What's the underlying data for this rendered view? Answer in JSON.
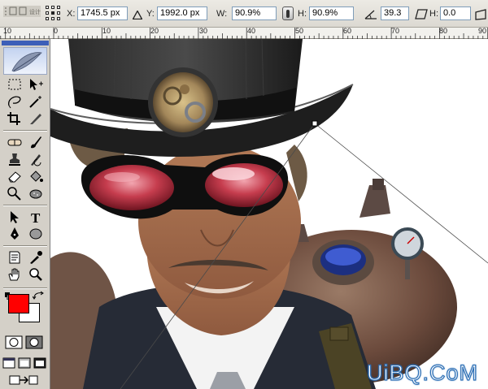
{
  "options_bar": {
    "x_label": "X:",
    "x_value": "1745.5 px",
    "y_label": "Y:",
    "y_value": "1992.0 px",
    "w_label": "W:",
    "w_value": "90.9%",
    "h_label": "H:",
    "h_value": "90.9%",
    "rotate_value": "39.3",
    "h_skew_label": "H:",
    "h_skew_value": "0.0"
  },
  "ruler": {
    "labels": [
      "10",
      "0",
      "10",
      "20",
      "30",
      "40",
      "50",
      "60",
      "70",
      "80",
      "90"
    ]
  },
  "toolbox": {
    "foreground_color": "#ff0000",
    "background_color": "#ffffff",
    "tools": [
      "marquee-icon",
      "move-icon",
      "lasso-icon",
      "magic-wand-icon",
      "crop-icon",
      "slice-icon",
      "healing-brush-icon",
      "brush-icon",
      "clone-stamp-icon",
      "history-brush-icon",
      "eraser-icon",
      "paint-bucket-icon",
      "dodge-icon",
      "sponge-icon",
      "path-select-icon",
      "type-icon",
      "pen-icon",
      "shape-icon",
      "notes-icon",
      "eyedropper-icon",
      "hand-icon",
      "zoom-icon"
    ]
  },
  "canvas": {
    "watermark": "UiBQ.CoM"
  }
}
